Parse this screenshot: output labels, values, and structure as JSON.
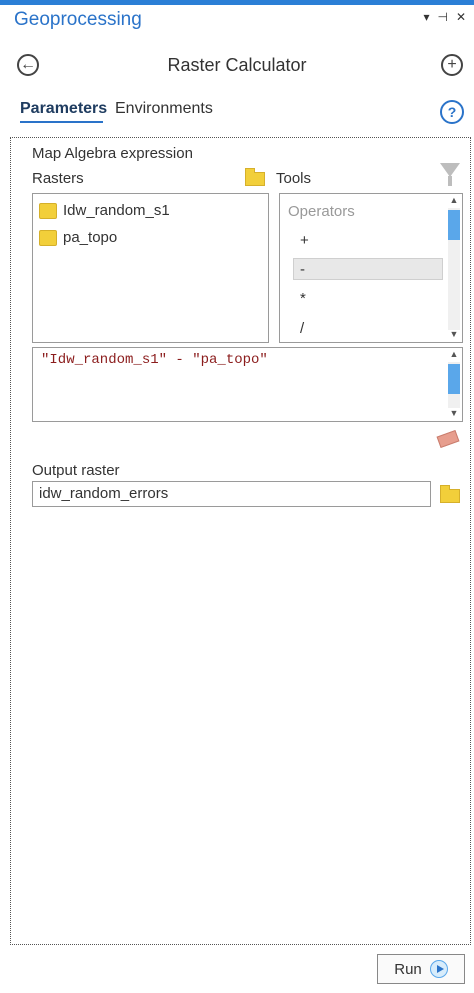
{
  "pane": {
    "title": "Geoprocessing",
    "controls": [
      "▾",
      "⊣",
      "✕"
    ]
  },
  "tool": {
    "title": "Raster Calculator",
    "back_icon": "back-arrow-icon",
    "add_icon": "plus-circle-icon"
  },
  "tabs": [
    {
      "label": "Parameters",
      "active": true
    },
    {
      "label": "Environments",
      "active": false
    }
  ],
  "help": {
    "glyph": "?"
  },
  "map_algebra": {
    "label": "Map Algebra expression",
    "rasters_label": "Rasters",
    "tools_label": "Tools",
    "rasters": [
      "Idw_random_s1",
      "pa_topo"
    ],
    "operators_header": "Operators",
    "operators": [
      "+",
      "-",
      "*",
      "/"
    ],
    "selected_operator": "-",
    "expression": "\"Idw_random_s1\" - \"pa_topo\""
  },
  "output": {
    "label": "Output raster",
    "value": "idw_random_errors"
  },
  "run": {
    "label": "Run"
  },
  "colors": {
    "accent": "#2a73c9",
    "topbar": "#2b7fd6",
    "folder": "#f2cf3a",
    "expression_text": "#8b1c1c"
  }
}
